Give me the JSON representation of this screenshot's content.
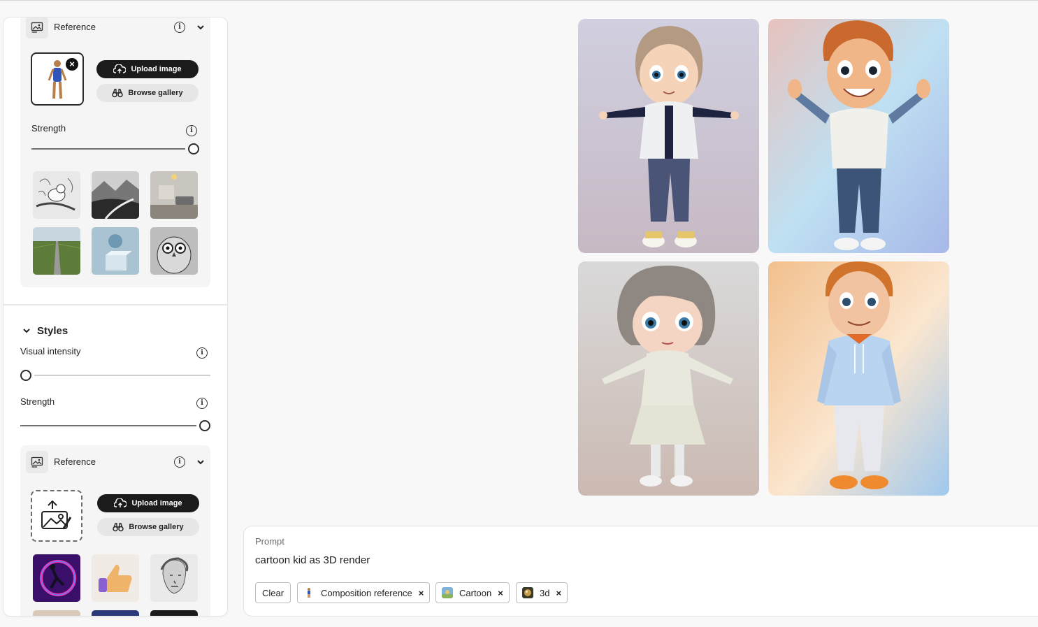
{
  "panel": {
    "reference_top": {
      "title": "Reference",
      "upload_label": "Upload image",
      "browse_label": "Browse gallery",
      "strength_label": "Strength",
      "strength_value": 1.0
    },
    "styles": {
      "title": "Styles",
      "visual_intensity_label": "Visual intensity",
      "visual_intensity_value": 0.0,
      "strength_label": "Strength",
      "strength_value": 1.0
    },
    "reference_bottom": {
      "title": "Reference",
      "upload_label": "Upload image",
      "browse_label": "Browse gallery"
    },
    "gallery_top_icons": [
      "bird-sketch-thumbnail",
      "mountain-landscape-thumbnail",
      "living-room-thumbnail",
      "road-field-thumbnail",
      "sphere-cube-thumbnail",
      "owl-sketch-thumbnail"
    ],
    "gallery_bottom_icons": [
      "neon-figure-thumbnail",
      "thumbs-up-thumbnail",
      "statue-portrait-thumbnail"
    ]
  },
  "prompt": {
    "label": "Prompt",
    "text": "cartoon kid as 3D render",
    "clear_label": "Clear",
    "chips": [
      {
        "label": "Composition reference",
        "icon": "figure-icon"
      },
      {
        "label": "Cartoon",
        "icon": "cartoon-style-icon"
      },
      {
        "label": "3d",
        "icon": "3d-style-icon"
      }
    ]
  },
  "colors": {
    "accent_dark": "#1b1b1b",
    "panel_bg": "#ffffff",
    "page_bg": "#f8f8f8"
  }
}
